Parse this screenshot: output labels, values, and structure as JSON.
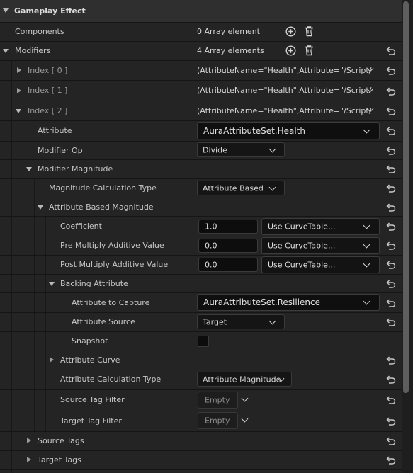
{
  "header": {
    "title": "Gameplay Effect"
  },
  "components": {
    "label": "Components",
    "value": "0 Array element"
  },
  "modifiers": {
    "label": "Modifiers",
    "value": "4 Array elements"
  },
  "indices": [
    {
      "label": "Index [ 0 ]",
      "value": "(AttributeName=\"Health\",Attribute=\"/Script/"
    },
    {
      "label": "Index [ 1 ]",
      "value": "(AttributeName=\"Health\",Attribute=\"/Script/"
    },
    {
      "label": "Index [ 2 ]",
      "value": "(AttributeName=\"Health\",Attribute=\"/Script/"
    }
  ],
  "attribute": {
    "label": "Attribute",
    "value": "AuraAttributeSet.Health"
  },
  "modifier_op": {
    "label": "Modifier Op",
    "value": "Divide"
  },
  "modifier_magnitude": {
    "label": "Modifier Magnitude"
  },
  "magnitude_calc_type": {
    "label": "Magnitude Calculation Type",
    "value": "Attribute Based"
  },
  "attribute_based_magnitude": {
    "label": "Attribute Based Magnitude"
  },
  "coefficient": {
    "label": "Coefficient",
    "value": "1.0",
    "curve": "Use CurveTable..."
  },
  "pre_multiply": {
    "label": "Pre Multiply Additive Value",
    "value": "0.0",
    "curve": "Use CurveTable..."
  },
  "post_multiply": {
    "label": "Post Multiply Additive Value",
    "value": "0.0",
    "curve": "Use CurveTable..."
  },
  "backing_attribute": {
    "label": "Backing Attribute"
  },
  "attribute_to_capture": {
    "label": "Attribute to Capture",
    "value": "AuraAttributeSet.Resilience"
  },
  "attribute_source": {
    "label": "Attribute Source",
    "value": "Target"
  },
  "snapshot": {
    "label": "Snapshot",
    "checked": false
  },
  "attribute_curve": {
    "label": "Attribute Curve"
  },
  "attribute_calc_type": {
    "label": "Attribute Calculation Type",
    "value": "Attribute Magnitude"
  },
  "source_tag_filter": {
    "label": "Source Tag Filter",
    "value": "Empty"
  },
  "target_tag_filter": {
    "label": "Target Tag Filter",
    "value": "Empty"
  },
  "source_tags": {
    "label": "Source Tags"
  },
  "target_tags": {
    "label": "Target Tags"
  },
  "icons": [
    "add-element-icon",
    "trash-icon",
    "reset-to-default-icon",
    "expand-triangle-icon",
    "collapse-triangle-icon",
    "chevron-down-icon"
  ]
}
